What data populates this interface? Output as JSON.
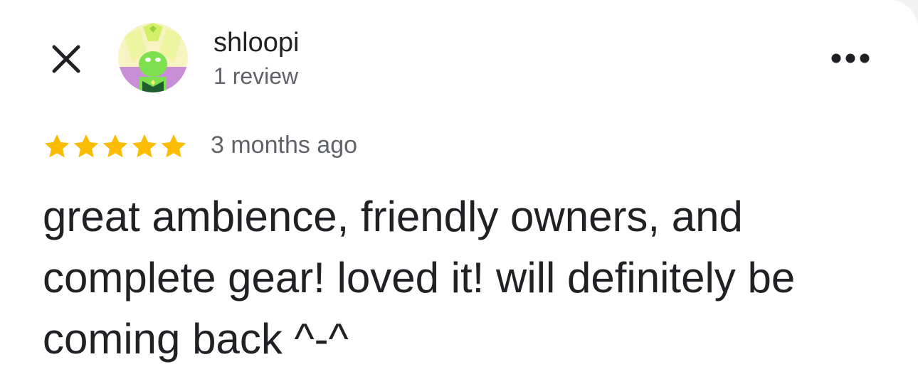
{
  "review": {
    "user_name": "shloopi",
    "review_count": "1 review",
    "rating": 5,
    "rating_max": 5,
    "timestamp": "3 months ago",
    "text": "great ambience, friendly owners, and complete gear! loved it! will definitely be coming back ^-^"
  },
  "icons": {
    "close": "close-icon",
    "more": "more-options-icon",
    "star": "star-icon",
    "avatar": "avatar-image"
  },
  "colors": {
    "star": "#FBBC04",
    "primary_text": "#202124",
    "secondary_text": "#5F6368",
    "background": "#FFFFFF"
  }
}
